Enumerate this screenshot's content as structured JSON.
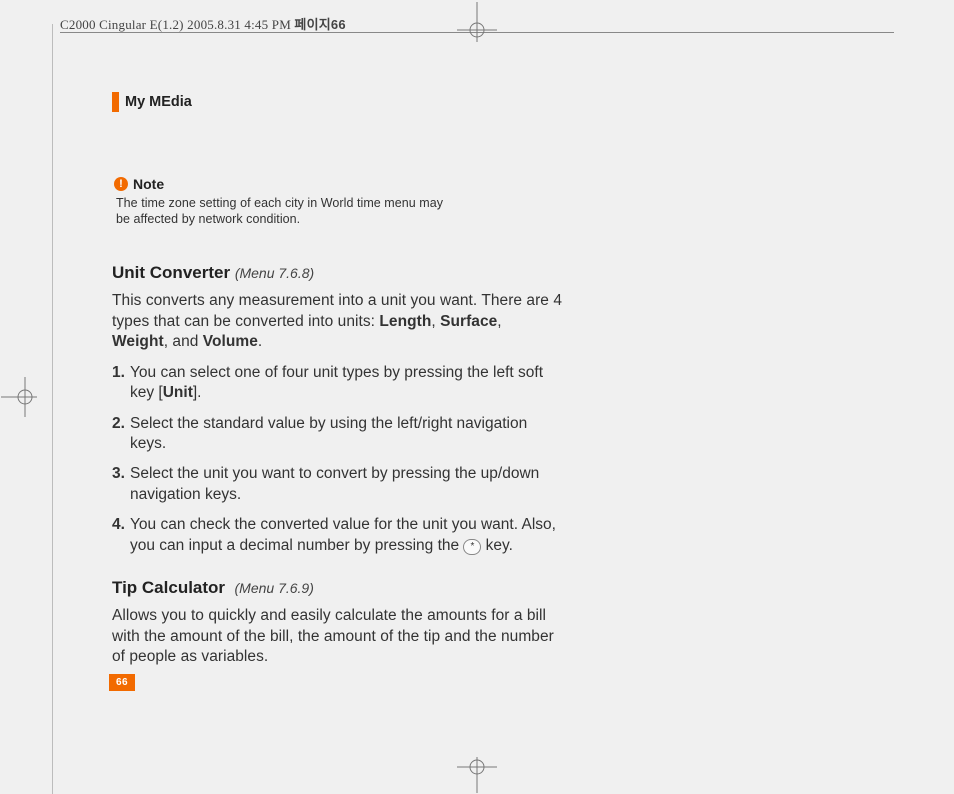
{
  "header": {
    "file_label": "C2000 Cingular E(1.2)  2005.8.31 4:45 PM",
    "korean_label": "페이지",
    "page_in_header": "66"
  },
  "section_title": "My MEdia",
  "note": {
    "icon_glyph": "!",
    "label": "Note",
    "body": "The time zone setting of each city in World time menu may be affected by network condition."
  },
  "unit_converter": {
    "heading": "Unit Converter",
    "menu_ref": "(Menu 7.6.8)",
    "intro_prefix": "This converts any measurement into a unit you want. There are 4 types that can be converted into units: ",
    "types": [
      "Length",
      "Surface",
      "Weight",
      "Volume"
    ],
    "intro_joiner_comma": ", ",
    "intro_joiner_and": ", and ",
    "intro_suffix": ".",
    "steps": [
      {
        "n": "1.",
        "pre": "You can select one of four unit types by pressing the left soft key [",
        "bold": "Unit",
        "post": "]."
      },
      {
        "n": "2.",
        "pre": "Select the standard value by using the left/right navigation keys.",
        "bold": "",
        "post": ""
      },
      {
        "n": "3.",
        "pre": "Select the unit you want to convert by pressing the up/down navigation keys.",
        "bold": "",
        "post": ""
      },
      {
        "n": "4.",
        "pre": "You can check the converted value for the unit you want. Also, you can input a decimal number by pressing the ",
        "bold": "",
        "post": " key.",
        "keycap": "*"
      }
    ]
  },
  "tip_calculator": {
    "heading": "Tip Calculator",
    "menu_ref": "(Menu 7.6.9)",
    "body": "Allows you to quickly and easily calculate the amounts for a bill with the amount of the bill, the amount of the tip and the number of people as variables."
  },
  "page_number": "66"
}
